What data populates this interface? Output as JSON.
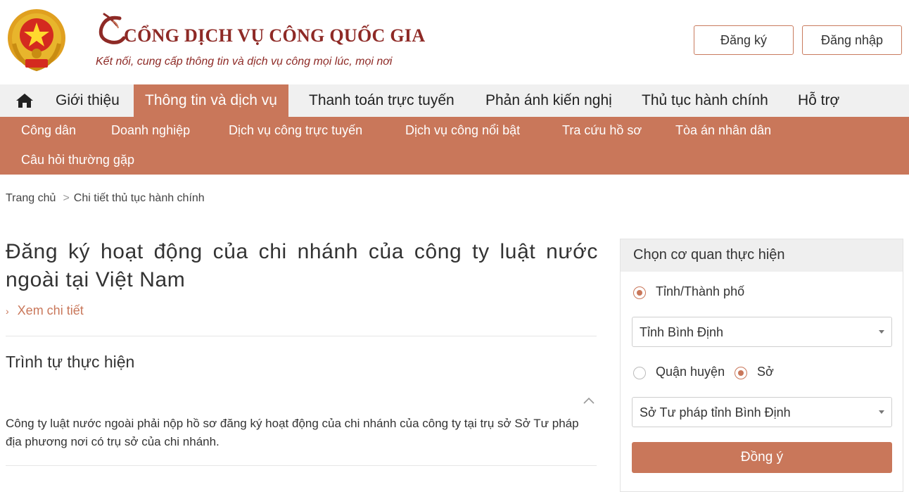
{
  "header": {
    "brand_title": "CỔNG DỊCH VỤ CÔNG QUỐC GIA",
    "tagline": "Kết nối, cung cấp thông tin và dịch vụ công mọi lúc, mọi nơi",
    "register_label": "Đăng ký",
    "login_label": "Đăng nhập"
  },
  "main_nav": {
    "home_icon": "home-icon",
    "items": [
      {
        "label": "Giới thiệu",
        "active": false
      },
      {
        "label": "Thông tin và dịch vụ",
        "active": true
      },
      {
        "label": "Thanh toán trực tuyến",
        "active": false
      },
      {
        "label": "Phản ánh kiến nghị",
        "active": false
      },
      {
        "label": "Thủ tục hành chính",
        "active": false
      },
      {
        "label": "Hỗ trợ",
        "active": false
      }
    ]
  },
  "sub_nav": {
    "items": [
      "Công dân",
      "Doanh nghiệp",
      "Dịch vụ công trực tuyến",
      "Dịch vụ công nổi bật",
      "Tra cứu hồ sơ",
      "Tòa án nhân dân",
      "Câu hỏi thường gặp"
    ]
  },
  "breadcrumb": {
    "home": "Trang chủ",
    "separator": ">",
    "current": "Chi tiết thủ tục hành chính"
  },
  "main": {
    "title": "Đăng ký hoạt động của chi nhánh của công ty luật nước ngoài tại Việt Nam",
    "detail_link": "Xem chi tiết",
    "section_title": "Trình tự thực hiện",
    "section_body": "Công ty luật nước ngoài phải nộp hồ sơ đăng ký hoạt động của chi nhánh của công ty tại trụ sở Sở Tư pháp địa phương nơi có trụ sở của chi nhánh."
  },
  "panel": {
    "title": "Chọn cơ quan thực hiện",
    "radio_province": {
      "label": "Tỉnh/Thành phố",
      "checked": true
    },
    "province_select": "Tỉnh Bình Định",
    "radio_district": {
      "label": "Quận huyện",
      "checked": false
    },
    "radio_department": {
      "label": "Sở",
      "checked": true
    },
    "department_select": "Sở Tư pháp tỉnh Bình Định",
    "agree_label": "Đồng ý"
  },
  "colors": {
    "accent": "#c9775a",
    "brand": "#8e2a26",
    "nav_bg": "#f0f0f0"
  }
}
